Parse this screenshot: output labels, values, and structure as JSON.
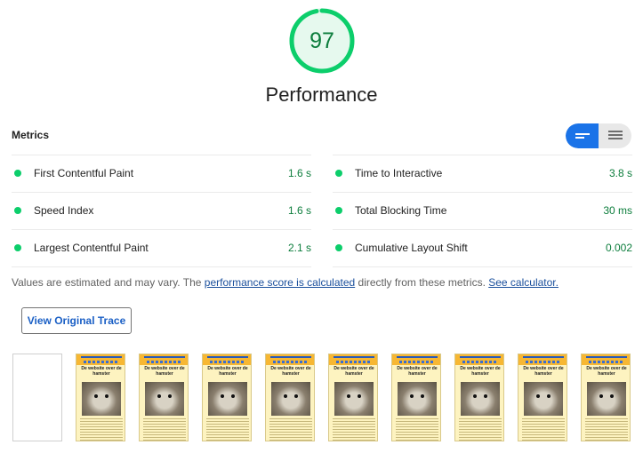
{
  "score": {
    "value": "97",
    "fraction": 0.97,
    "color": "#0cce6b",
    "track_color": "#d7f5e4",
    "fill_color": "#e6f9ee"
  },
  "category": {
    "title": "Performance"
  },
  "metrics": {
    "header": "Metrics",
    "left": [
      {
        "label": "First Contentful Paint",
        "value": "1.6 s"
      },
      {
        "label": "Speed Index",
        "value": "1.6 s"
      },
      {
        "label": "Largest Contentful Paint",
        "value": "2.1 s"
      }
    ],
    "right": [
      {
        "label": "Time to Interactive",
        "value": "3.8 s"
      },
      {
        "label": "Total Blocking Time",
        "value": "30 ms"
      },
      {
        "label": "Cumulative Layout Shift",
        "value": "0.002"
      }
    ],
    "status_color": "#0cce6b"
  },
  "note": {
    "prefix": "Values are estimated and may vary. The ",
    "link1": "performance score is calculated",
    "middle": " directly from these metrics. ",
    "link2": "See calculator."
  },
  "trace_button": {
    "label": "View Original Trace"
  },
  "filmstrip": {
    "frame_title": "De website over de hamster",
    "frames": [
      "blank",
      "content",
      "content",
      "content",
      "content",
      "content",
      "content",
      "content",
      "content",
      "content"
    ]
  },
  "icons": {
    "compact_view": "compact-list-icon",
    "expanded_view": "expanded-list-icon"
  },
  "colors": {
    "accent": "#1a73e8",
    "pass": "#0cce6b",
    "pass_text": "#0c7d3c"
  }
}
